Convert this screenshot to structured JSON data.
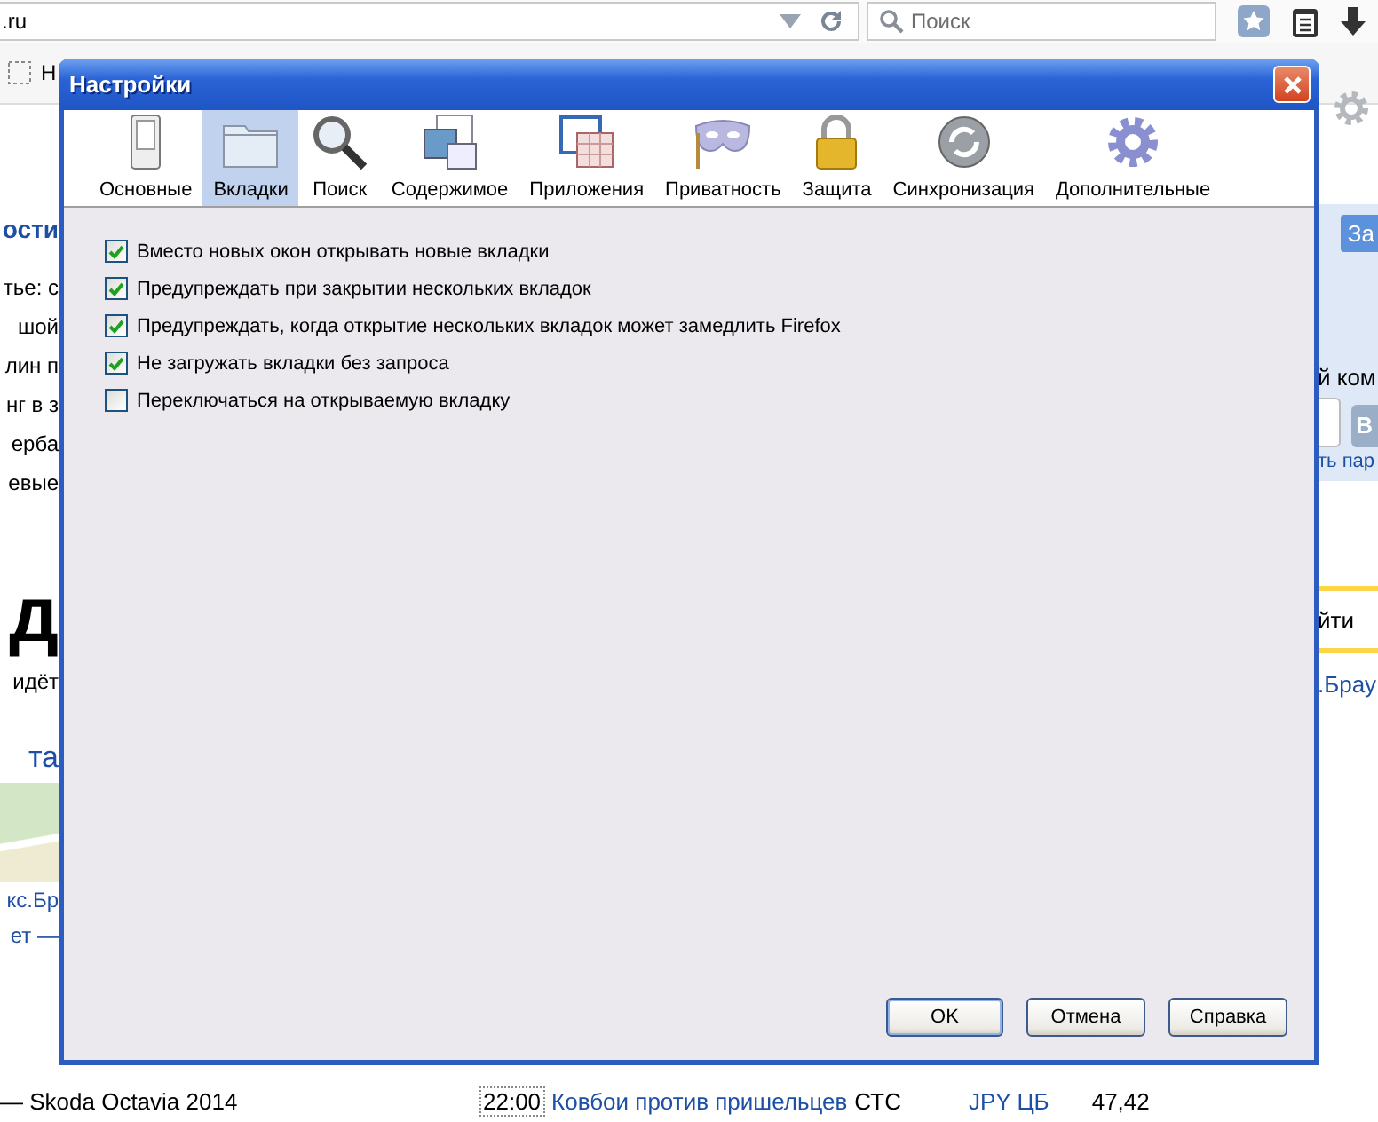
{
  "browser": {
    "url": ".ru",
    "search_placeholder": "Поиск",
    "bookmark": "Н"
  },
  "page": {
    "left": [
      {
        "kind": "heading",
        "text": "ости"
      },
      {
        "kind": "text",
        "text": "тье: с"
      },
      {
        "kind": "text",
        "text": "шой"
      },
      {
        "kind": "text",
        "text": "лин п"
      },
      {
        "kind": "text",
        "text": "нг в з"
      },
      {
        "kind": "text",
        "text": "ерба"
      },
      {
        "kind": "text",
        "text": "евые"
      },
      {
        "kind": "big",
        "text": "д"
      },
      {
        "kind": "text",
        "text": "идёт"
      },
      {
        "kind": "link",
        "text": "та"
      },
      {
        "kind": "image"
      },
      {
        "kind": "small-link",
        "text": "кс.Бр"
      },
      {
        "kind": "small-link",
        "text": "ет —"
      }
    ],
    "right": [
      {
        "kind": "button",
        "text": "За"
      },
      {
        "kind": "text",
        "text": "й ком"
      },
      {
        "kind": "login",
        "text": "В"
      },
      {
        "kind": "link",
        "text": "ть пар"
      },
      {
        "kind": "search",
        "text": "йти"
      },
      {
        "kind": "link",
        "text": ".Брау"
      }
    ],
    "bottom": {
      "news": "— Skoda Octavia 2014",
      "time": "22:00",
      "show": "Ковбои против пришельцев",
      "channel": "СТС",
      "rate_name": "JPY ЦБ",
      "rate_value": "47,42"
    }
  },
  "dialog": {
    "title": "Настройки",
    "tabs": [
      {
        "label": "Основные",
        "selected": false
      },
      {
        "label": "Вкладки",
        "selected": true
      },
      {
        "label": "Поиск",
        "selected": false
      },
      {
        "label": "Содержимое",
        "selected": false
      },
      {
        "label": "Приложения",
        "selected": false
      },
      {
        "label": "Приватность",
        "selected": false
      },
      {
        "label": "Защита",
        "selected": false
      },
      {
        "label": "Синхронизация",
        "selected": false
      },
      {
        "label": "Дополнительные",
        "selected": false
      }
    ],
    "options": [
      {
        "label": "Вместо новых окон открывать новые вкладки",
        "checked": true
      },
      {
        "label": "Предупреждать при закрытии нескольких вкладок",
        "checked": true
      },
      {
        "label": "Предупреждать, когда открытие нескольких вкладок может замедлить Firefox",
        "checked": true
      },
      {
        "label": "Не загружать вкладки без запроса",
        "checked": true
      },
      {
        "label": "Переключаться на открываемую вкладку",
        "checked": false
      }
    ],
    "buttons": [
      {
        "label": "OK",
        "kind": "default"
      },
      {
        "label": "Отмена",
        "kind": "normal"
      },
      {
        "label": "Справка",
        "kind": "normal"
      }
    ]
  }
}
